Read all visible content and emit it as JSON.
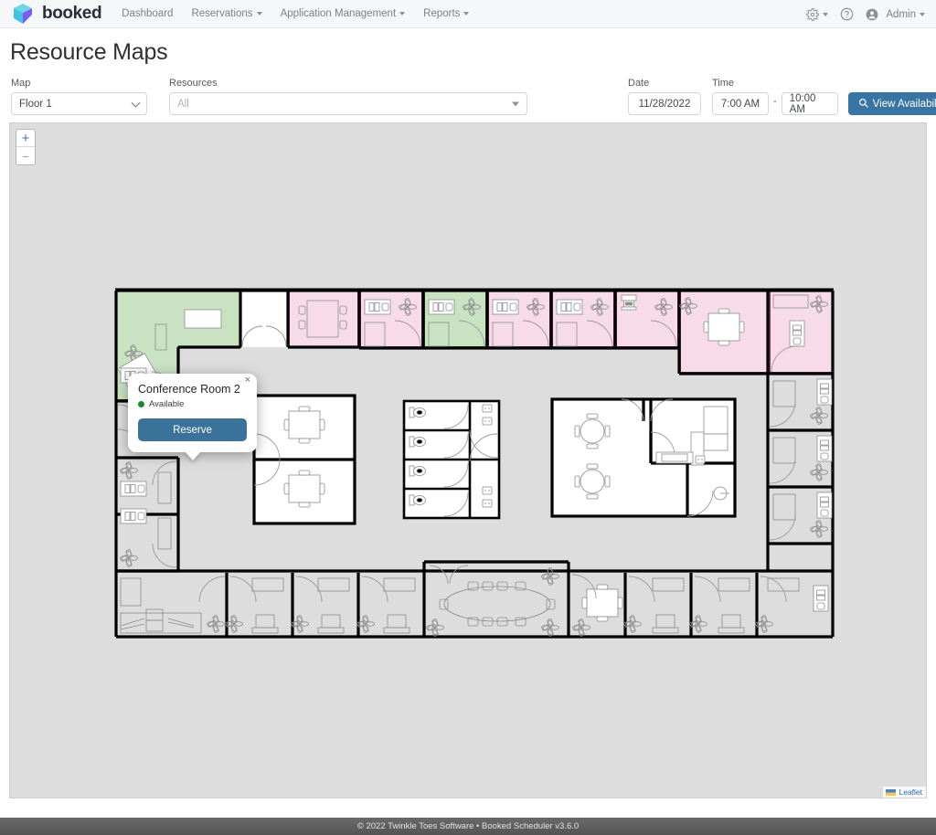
{
  "navbar": {
    "brand": "booked",
    "logo_icon": "booked-cube-logo",
    "links": [
      {
        "label": "Dashboard",
        "has_caret": false
      },
      {
        "label": "Reservations",
        "has_caret": true
      },
      {
        "label": "Application Management",
        "has_caret": true
      },
      {
        "label": "Reports",
        "has_caret": true
      }
    ],
    "settings_icon": "gear-icon",
    "help_icon": "question-circle-icon",
    "user_icon": "user-avatar-icon",
    "user_label": "Admin"
  },
  "page": {
    "title": "Resource Maps"
  },
  "filters": {
    "map": {
      "label": "Map",
      "value": "Floor 1"
    },
    "resources": {
      "label": "Resources",
      "placeholder": "All",
      "value": ""
    },
    "date": {
      "label": "Date",
      "value": "11/28/2022"
    },
    "time": {
      "label": "Time",
      "start": "7:00 AM",
      "separator": "-",
      "end": "10:00 AM"
    },
    "view_availability": {
      "label": "View Availability",
      "icon": "search-icon",
      "color": "#3875a5"
    }
  },
  "map": {
    "zoom_in": "+",
    "zoom_out": "−",
    "attribution": "Leaflet",
    "background": "#dddddd",
    "colors": {
      "available": "#c9e3c2",
      "available_border": "#2c6b2c",
      "unavailable": "#f8dbe8",
      "unavailable_border": "#913a5e",
      "wall": "#000000",
      "furniture": "#8a8a8a"
    }
  },
  "popup": {
    "title": "Conference Room 2",
    "status": "Available",
    "status_color": "#128c2e",
    "reserve_label": "Reserve",
    "close_icon": "close-icon"
  },
  "footer": {
    "text": "© 2022 Twinkle Toes Software • Booked Scheduler v3.6.0"
  }
}
